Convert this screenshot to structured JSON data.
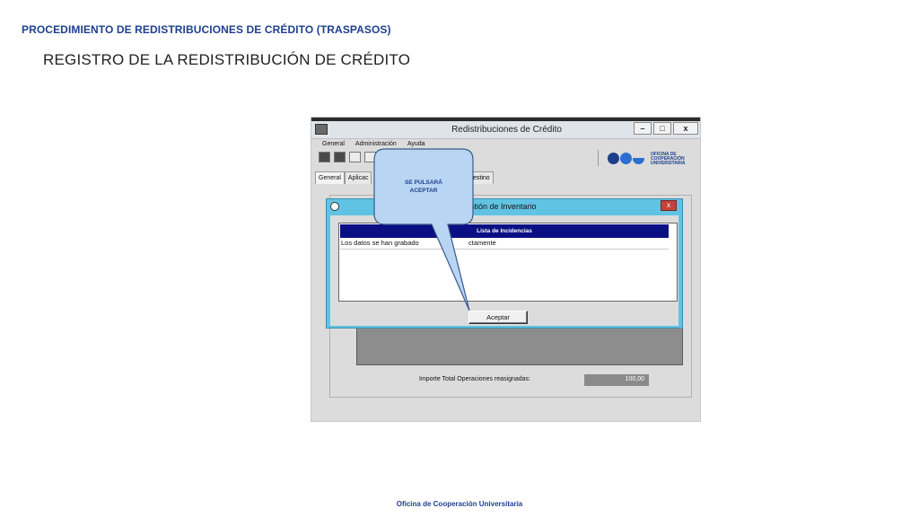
{
  "slide": {
    "heading": "PROCEDIMIENTO DE REDISTRIBUCIONES DE CRÉDITO (TRASPASOS)",
    "subheading": "REGISTRO DE LA REDISTRIBUCIÓN DE CRÉDITO",
    "footer": "Oficina de Cooperación Universitaria"
  },
  "app": {
    "window_title": "Redistribuciones de Crédito",
    "window_buttons": {
      "minimize": "–",
      "maximize": "□",
      "close": "x"
    },
    "menu": [
      "General",
      "Administración",
      "Ayuda"
    ],
    "tabs": [
      "General",
      "Aplicac",
      "estino"
    ],
    "logo_text": [
      "OFICINA DE",
      "COOPERACIÓN",
      "UNIVERSITARIA"
    ],
    "total_label": "Importe Total Operaciones reasignadas:",
    "total_value": "100,00"
  },
  "dialog": {
    "title": "stión de Inventario",
    "close": "x",
    "list_header": "Lista de Incidencias",
    "row": "Los datos se han grabado",
    "row_tail": "ctamente",
    "accept": "Aceptar"
  },
  "callout": {
    "line1": "SE PULSARÁ",
    "line2": "ACEPTAR"
  },
  "colors": {
    "heading": "#1f3f8f",
    "dialog_frame": "#61c3e4",
    "list_header": "#0a0f83",
    "callout_fill": "#b8d6f3",
    "callout_stroke": "#3a5a8a"
  }
}
